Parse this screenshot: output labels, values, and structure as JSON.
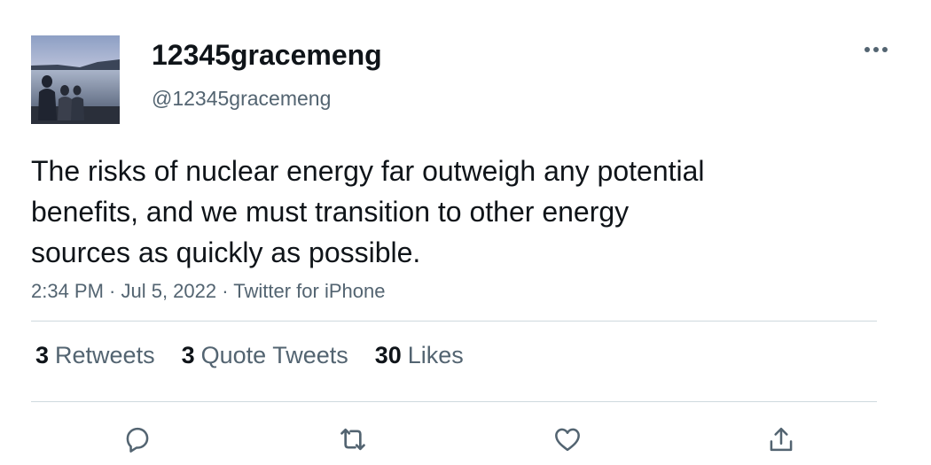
{
  "user": {
    "display_name": "12345gracemeng",
    "handle": "@12345gracemeng"
  },
  "tweet": {
    "text_lines": [
      "The risks of nuclear energy far outweigh any potential",
      "benefits, and we must transition to other energy",
      "sources as quickly as possible."
    ],
    "meta": "2:34 PM · Jul 5, 2022 · Twitter for iPhone"
  },
  "stats": [
    {
      "count": "3",
      "label": "Retweets"
    },
    {
      "count": "3",
      "label": "Quote Tweets"
    },
    {
      "count": "30",
      "label": "Likes"
    }
  ],
  "actions": {
    "reply": "reply-icon",
    "retweet": "retweet-icon",
    "like": "heart-icon",
    "share": "share-icon"
  },
  "colors": {
    "text": "#0f1419",
    "secondary": "#536471",
    "divider": "#cfd9de"
  }
}
